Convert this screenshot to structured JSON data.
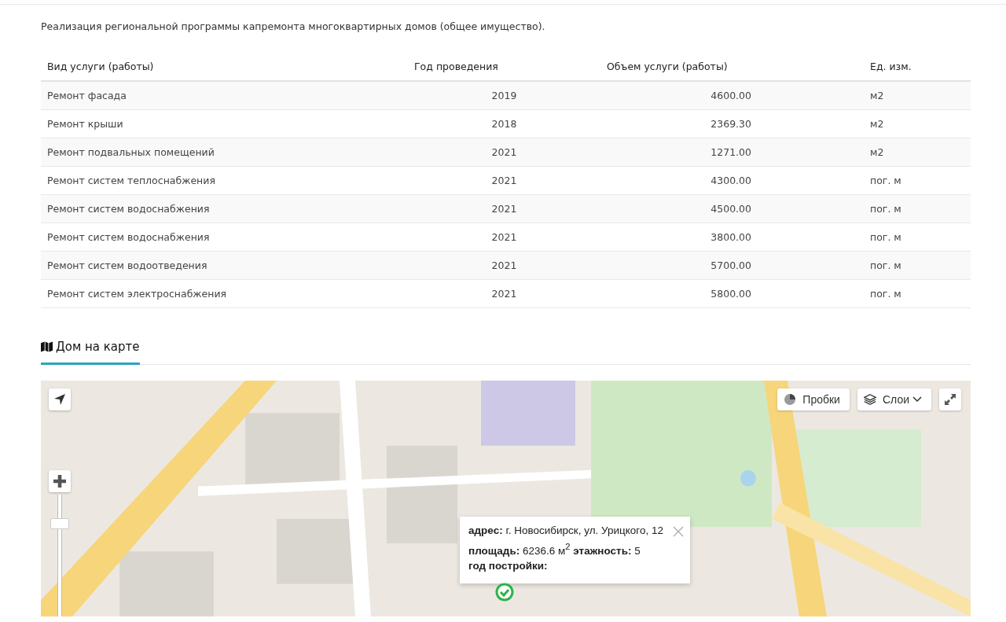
{
  "intro": "Реализация региональной программы капремонта многоквартирных домов (общее имущество).",
  "table": {
    "columns": [
      "Вид услуги (работы)",
      "Год проведения",
      "Объем услуги (работы)",
      "Ед. изм."
    ],
    "rows": [
      [
        "Ремонт фасада",
        "2019",
        "4600.00",
        "м2"
      ],
      [
        "Ремонт крыши",
        "2018",
        "2369.30",
        "м2"
      ],
      [
        "Ремонт подвальных помещений",
        "2021",
        "1271.00",
        "м2"
      ],
      [
        "Ремонт систем теплоснабжения",
        "2021",
        "4300.00",
        "пог. м"
      ],
      [
        "Ремонт систем водоснабжения",
        "2021",
        "4500.00",
        "пог. м"
      ],
      [
        "Ремонт систем водоснабжения",
        "2021",
        "3800.00",
        "пог. м"
      ],
      [
        "Ремонт систем водоотведения",
        "2021",
        "5700.00",
        "пог. м"
      ],
      [
        "Ремонт систем электроснабжения",
        "2021",
        "5800.00",
        "пог. м"
      ]
    ]
  },
  "map_section": {
    "title": "Дом на карте",
    "map": {
      "kind": "picture",
      "zoom": {
        "level": 0.8
      },
      "traffic_button": "Пробки",
      "layers_button": "Слои",
      "popup": {
        "lines": [
          "**адрес:** г. Новосибирск, ул. Урицкого, 12",
          "**площадь:** 6236.6 м$^{2}$ **этажность:** 5",
          "**год постройки:**"
        ]
      }
    }
  }
}
